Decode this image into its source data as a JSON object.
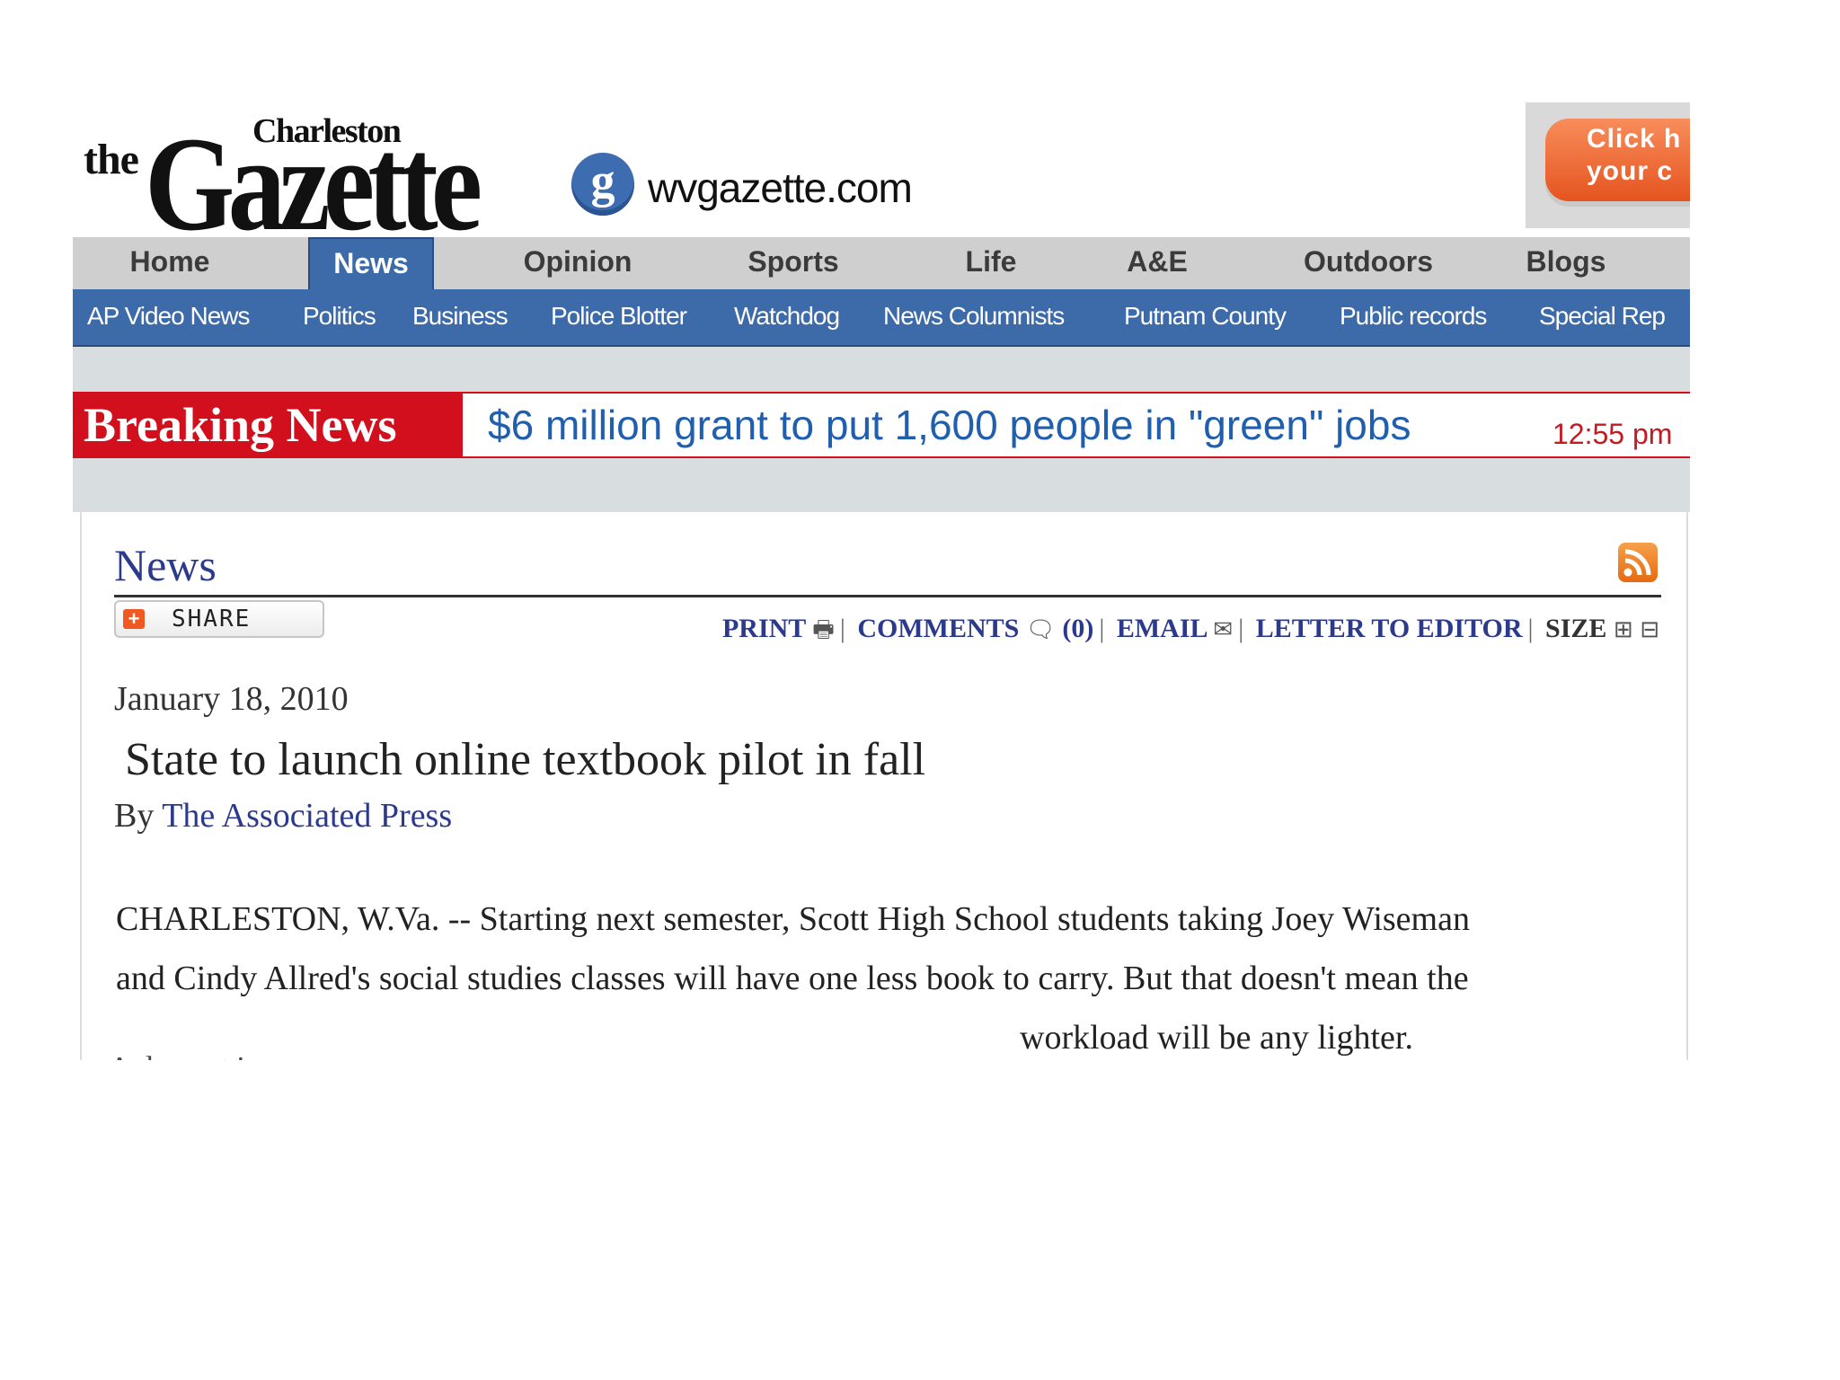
{
  "masthead": {
    "logo_the": "the",
    "logo_city": "Charleston",
    "logo_name": "Gazette",
    "badge_letter": "g",
    "site_url": "wvgazette.com"
  },
  "ad": {
    "line1": "Click h",
    "line2": "your c"
  },
  "nav": {
    "tabs": [
      "Home",
      "News",
      "Opinion",
      "Sports",
      "Life",
      "A&E",
      "Outdoors",
      "Blogs"
    ],
    "active_tab": "News",
    "sub_items": [
      "AP Video News",
      "Politics",
      "Business",
      "Police Blotter",
      "Watchdog",
      "News Columnists",
      "Putnam County",
      "Public records",
      "Special Rep"
    ]
  },
  "breaking": {
    "label": "Breaking News",
    "headline": "$6 million grant to put 1,600 people in \"green\" jobs",
    "time": "12:55 pm"
  },
  "article": {
    "section": "News",
    "share_label": "SHARE",
    "toolbar": {
      "print": "PRINT",
      "comments": "COMMENTS",
      "comments_count": "(0)",
      "email": "EMAIL",
      "letter": "LETTER TO EDITOR",
      "size": "SIZE"
    },
    "date": "January 18, 2010",
    "headline": "State to launch online textbook pilot in fall",
    "byline_prefix": "By",
    "author": "The Associated Press",
    "paragraph_lines": [
      "CHARLESTON, W.Va. -- Starting next semester, Scott High School students taking Joey Wiseman",
      "and Cindy Allred's social studies classes will have one less book to carry. But that doesn't mean the",
      "workload will be any lighter."
    ],
    "cut_off_text": "Advertis"
  },
  "colors": {
    "nav_blue": "#3d6aa8",
    "breaking_red": "#d10f1d",
    "link_navy": "#2c3a8c",
    "headline_blue": "#1f5fae"
  }
}
